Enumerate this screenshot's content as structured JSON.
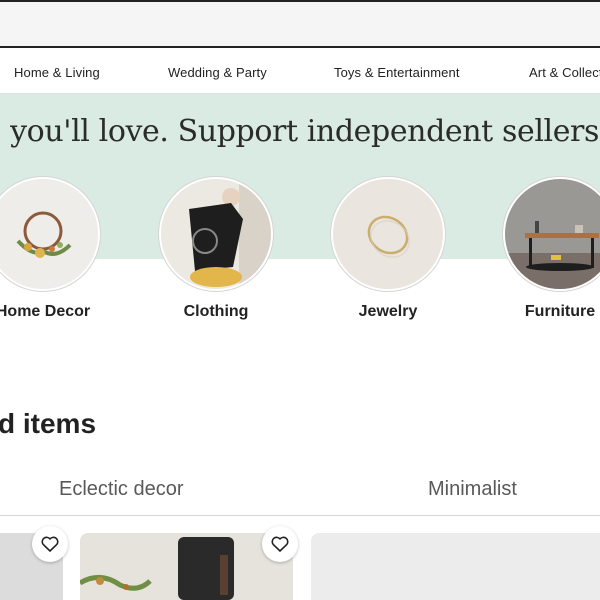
{
  "nav": {
    "items": [
      {
        "label": "Home & Living"
      },
      {
        "label": "Wedding & Party"
      },
      {
        "label": "Toys & Entertainment"
      },
      {
        "label": "Art & Collectibles"
      }
    ]
  },
  "banner": {
    "tagline": "s you'll love. Support independent sellers. Only on Etsy."
  },
  "categories": [
    {
      "label": "Home Decor",
      "icon": "wreath-photo"
    },
    {
      "label": "Clothing",
      "icon": "fashion-photo"
    },
    {
      "label": "Jewelry",
      "icon": "ring-photo"
    },
    {
      "label": "Furniture",
      "icon": "table-photo"
    }
  ],
  "section": {
    "title": "d items"
  },
  "style_tabs": [
    {
      "label": "Eclectic decor"
    },
    {
      "label": "Minimalist"
    }
  ],
  "colors": {
    "banner_bg": "#d9ebe2",
    "text": "#222222",
    "tab_text": "#595959"
  }
}
